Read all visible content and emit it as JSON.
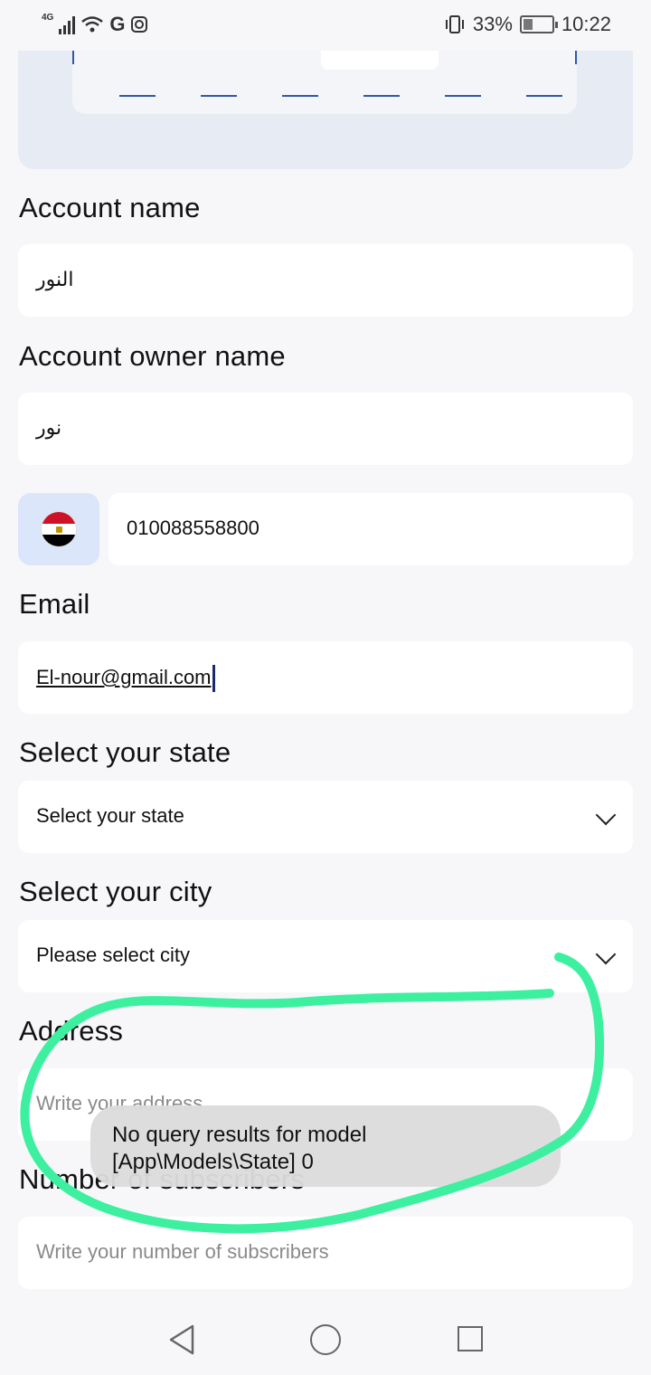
{
  "status_bar": {
    "network": "4G",
    "app_letter": "G",
    "battery": "33%",
    "battery_level": 0.33,
    "time": "10:22"
  },
  "form": {
    "account_name": {
      "label": "Account name",
      "value": "النور"
    },
    "account_owner_name": {
      "label": "Account owner name",
      "value": "نور"
    },
    "phone": {
      "country": "Egypt",
      "value": "010088558800"
    },
    "email": {
      "label": "Email",
      "value": "El-nour@gmail.com"
    },
    "state": {
      "label": "Select your state",
      "selected": "Select your state"
    },
    "city": {
      "label": "Select your city",
      "selected": "Please select city"
    },
    "address": {
      "label": "Address",
      "placeholder": "Write your address"
    },
    "subscribers": {
      "label": "Number of subscribers",
      "placeholder": "Write your number of subscribers"
    }
  },
  "toast": {
    "line1": "No query results for model",
    "line2": "[App\\Models\\State] 0"
  },
  "colors": {
    "annotation": "#3df0a0",
    "accent": "#2f5aa8",
    "card_bg": "#e6ebf4"
  }
}
